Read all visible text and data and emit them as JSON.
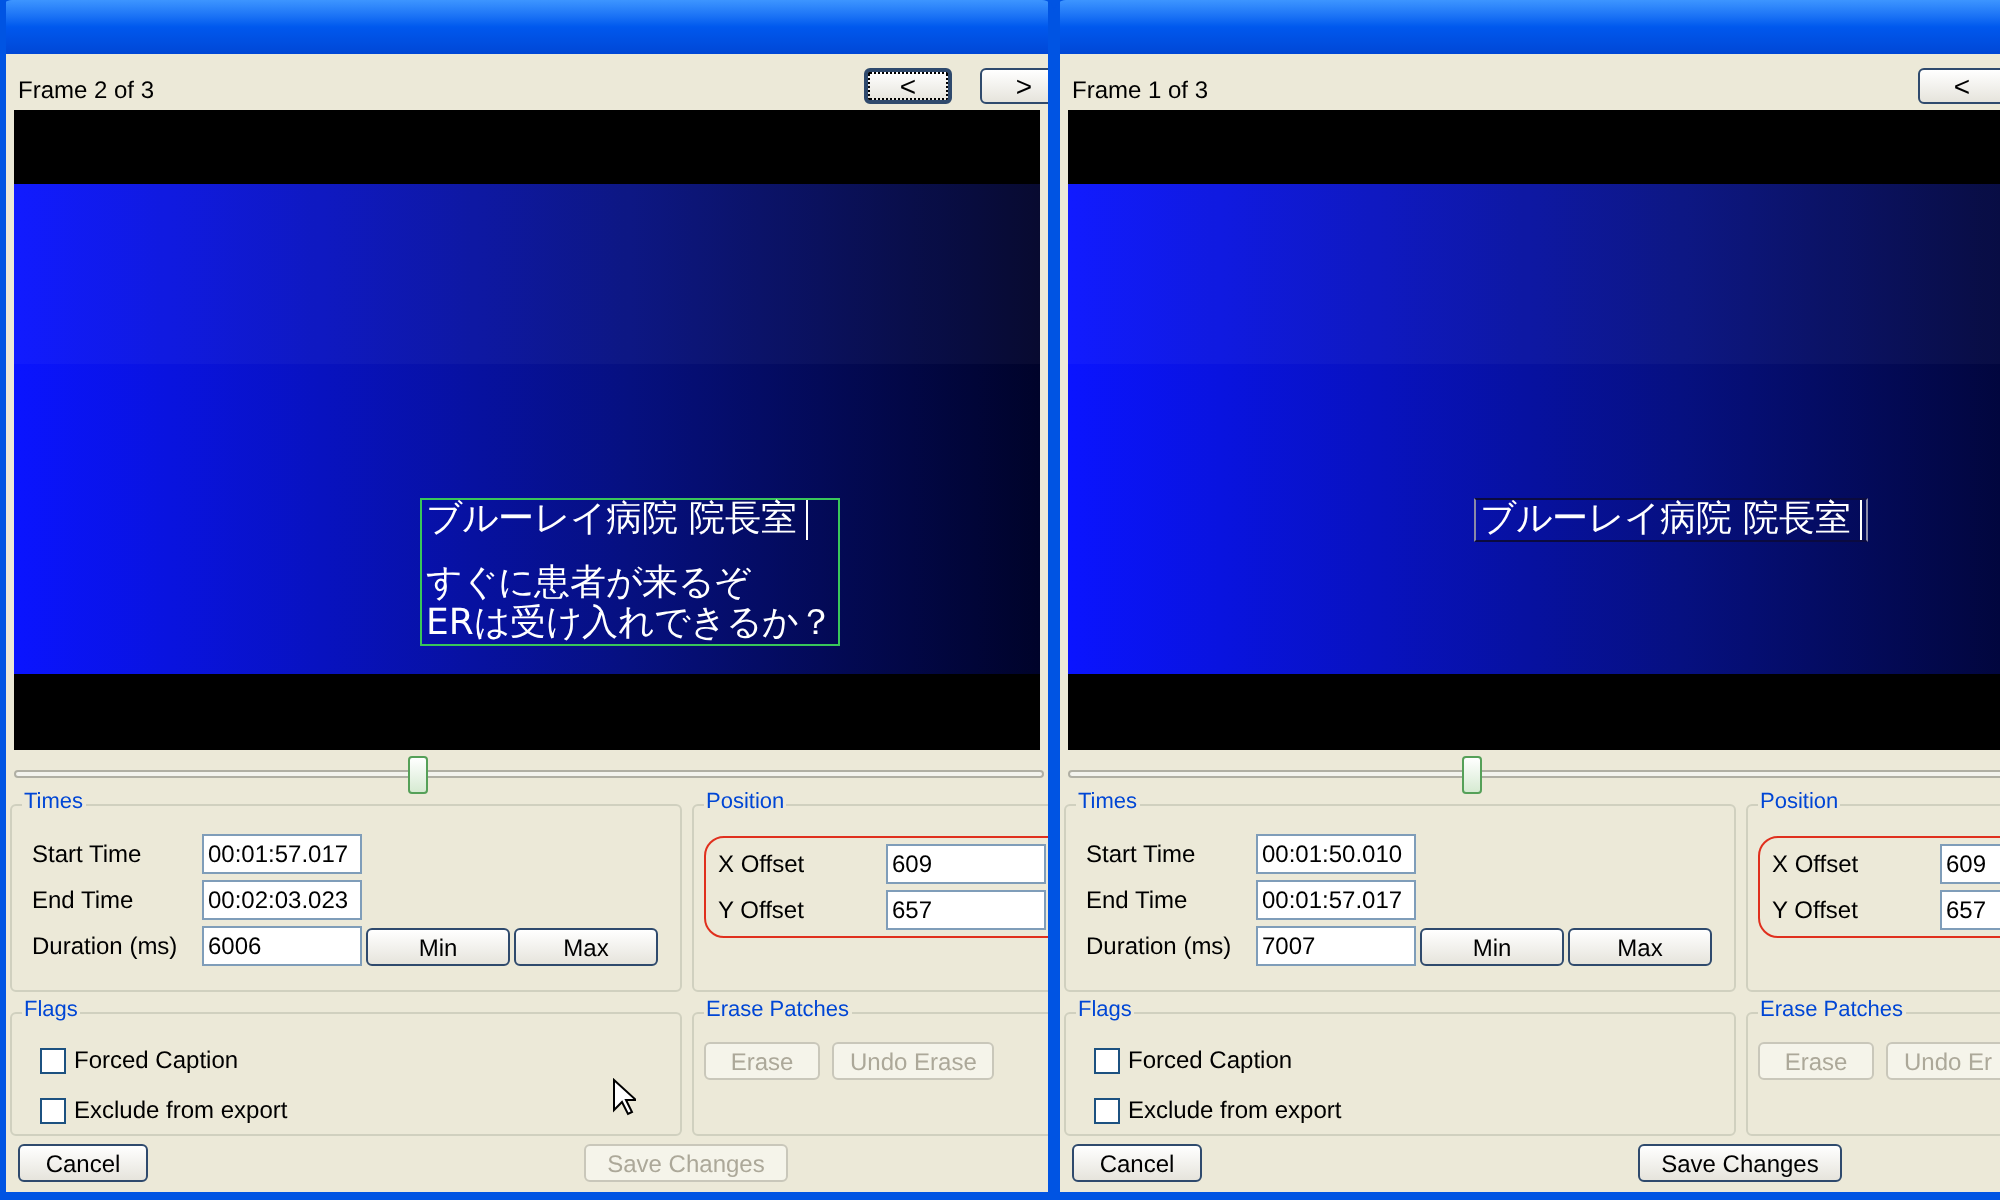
{
  "windows": [
    {
      "frame_label": "Frame 2 of 3",
      "nav_buttons": [
        {
          "label": "<",
          "focused": true
        },
        {
          "label": ">",
          "focused": false
        }
      ],
      "caption": {
        "highlighted": true,
        "blocks": [
          [
            "ブルーレイ病院 院長室"
          ],
          [
            "すぐに患者が来るぞ",
            "ERは受け入れできるか？"
          ]
        ]
      },
      "timeline": {
        "level": 0.39
      },
      "times": {
        "title": "Times",
        "fields": [
          {
            "label": "Start Time",
            "value": "00:01:57.017"
          },
          {
            "label": "End Time",
            "value": "00:02:03.023"
          },
          {
            "label": "Duration (ms)",
            "value": "6006"
          }
        ],
        "buttons": [
          "Min",
          "Max"
        ]
      },
      "position": {
        "title": "Position",
        "fields": [
          {
            "label": "X Offset",
            "value": "609"
          },
          {
            "label": "Y Offset",
            "value": "657"
          }
        ]
      },
      "flags": {
        "title": "Flags",
        "items": [
          {
            "label": "Forced Caption",
            "checked": false
          },
          {
            "label": "Exclude from export",
            "checked": false
          }
        ]
      },
      "erase": {
        "title": "Erase Patches",
        "buttons": [
          {
            "label": "Erase",
            "disabled": true
          },
          {
            "label": "Undo Erase",
            "disabled": true
          }
        ]
      },
      "cancel": "Cancel",
      "save": {
        "label": "Save Changes",
        "disabled": true
      },
      "mouse_pointer": true
    },
    {
      "frame_label": "Frame 1 of 3",
      "nav_buttons": [
        {
          "label": "<",
          "focused": false
        }
      ],
      "caption": {
        "highlighted": false,
        "blocks": [
          [
            "ブルーレイ病院 院長室"
          ]
        ]
      },
      "timeline": {
        "level": 0.39
      },
      "times": {
        "title": "Times",
        "fields": [
          {
            "label": "Start Time",
            "value": "00:01:50.010"
          },
          {
            "label": "End Time",
            "value": "00:01:57.017"
          },
          {
            "label": "Duration (ms)",
            "value": "7007"
          }
        ],
        "buttons": [
          "Min",
          "Max"
        ]
      },
      "position": {
        "title": "Position",
        "fields": [
          {
            "label": "X Offset",
            "value": "609"
          },
          {
            "label": "Y Offset",
            "value": "657"
          }
        ]
      },
      "flags": {
        "title": "Flags",
        "items": [
          {
            "label": "Forced Caption",
            "checked": false
          },
          {
            "label": "Exclude from export",
            "checked": false
          }
        ]
      },
      "erase": {
        "title": "Erase Patches",
        "buttons": [
          {
            "label": "Erase",
            "disabled": true
          },
          {
            "label": "Undo Er",
            "disabled": true
          }
        ]
      },
      "cancel": "Cancel",
      "save": {
        "label": "Save Changes",
        "disabled": false
      },
      "mouse_pointer": false
    }
  ]
}
